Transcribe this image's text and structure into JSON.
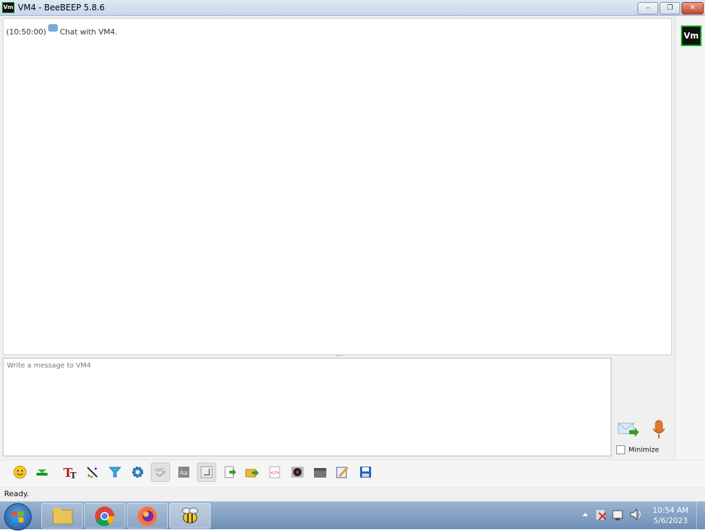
{
  "window": {
    "title": "VM4 - BeeBEEP 5.8.6",
    "app_icon_text": "Vm",
    "min_label": "–",
    "max_label": "❐",
    "close_label": "✕"
  },
  "chat": {
    "log": [
      {
        "time": "(10:50:00)",
        "icon": "chat-bubble-icon",
        "text": "Chat with VM4."
      }
    ],
    "avatar_text": "Vm"
  },
  "composer": {
    "placeholder": "Write a message to VM4",
    "minimize_label": "Minimize"
  },
  "toolbar": {
    "icons": [
      "emoticon-icon",
      "green-arrow-icon",
      "text-format-icon",
      "pencil-icon",
      "filter-icon",
      "gear-icon",
      "spellcheck-icon",
      "font-icon",
      "compact-icon",
      "send-file-icon",
      "folder-icon",
      "html-icon",
      "record-icon",
      "archive-icon",
      "notes-icon",
      "save-icon"
    ]
  },
  "status": {
    "text": "Ready."
  },
  "taskbar": {
    "time": "10:54 AM",
    "date": "5/6/2023"
  },
  "colors": {
    "accent": "#18b318",
    "taskbar": "#7e9cc2",
    "close": "#c64530"
  }
}
